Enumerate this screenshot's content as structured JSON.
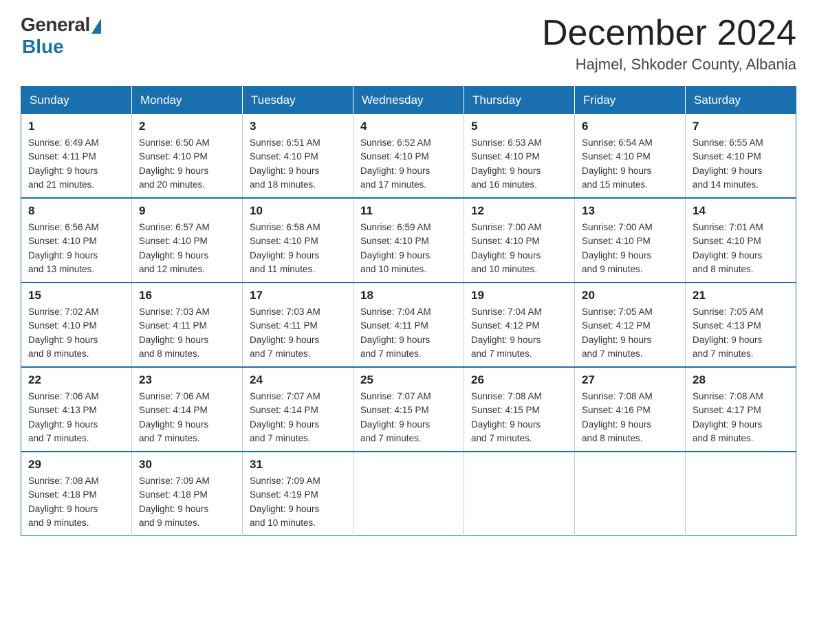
{
  "logo": {
    "general": "General",
    "blue": "Blue"
  },
  "title": "December 2024",
  "location": "Hajmel, Shkoder County, Albania",
  "days_of_week": [
    "Sunday",
    "Monday",
    "Tuesday",
    "Wednesday",
    "Thursday",
    "Friday",
    "Saturday"
  ],
  "weeks": [
    [
      {
        "day": "1",
        "sunrise": "6:49 AM",
        "sunset": "4:11 PM",
        "daylight": "9 hours and 21 minutes."
      },
      {
        "day": "2",
        "sunrise": "6:50 AM",
        "sunset": "4:10 PM",
        "daylight": "9 hours and 20 minutes."
      },
      {
        "day": "3",
        "sunrise": "6:51 AM",
        "sunset": "4:10 PM",
        "daylight": "9 hours and 18 minutes."
      },
      {
        "day": "4",
        "sunrise": "6:52 AM",
        "sunset": "4:10 PM",
        "daylight": "9 hours and 17 minutes."
      },
      {
        "day": "5",
        "sunrise": "6:53 AM",
        "sunset": "4:10 PM",
        "daylight": "9 hours and 16 minutes."
      },
      {
        "day": "6",
        "sunrise": "6:54 AM",
        "sunset": "4:10 PM",
        "daylight": "9 hours and 15 minutes."
      },
      {
        "day": "7",
        "sunrise": "6:55 AM",
        "sunset": "4:10 PM",
        "daylight": "9 hours and 14 minutes."
      }
    ],
    [
      {
        "day": "8",
        "sunrise": "6:56 AM",
        "sunset": "4:10 PM",
        "daylight": "9 hours and 13 minutes."
      },
      {
        "day": "9",
        "sunrise": "6:57 AM",
        "sunset": "4:10 PM",
        "daylight": "9 hours and 12 minutes."
      },
      {
        "day": "10",
        "sunrise": "6:58 AM",
        "sunset": "4:10 PM",
        "daylight": "9 hours and 11 minutes."
      },
      {
        "day": "11",
        "sunrise": "6:59 AM",
        "sunset": "4:10 PM",
        "daylight": "9 hours and 10 minutes."
      },
      {
        "day": "12",
        "sunrise": "7:00 AM",
        "sunset": "4:10 PM",
        "daylight": "9 hours and 10 minutes."
      },
      {
        "day": "13",
        "sunrise": "7:00 AM",
        "sunset": "4:10 PM",
        "daylight": "9 hours and 9 minutes."
      },
      {
        "day": "14",
        "sunrise": "7:01 AM",
        "sunset": "4:10 PM",
        "daylight": "9 hours and 8 minutes."
      }
    ],
    [
      {
        "day": "15",
        "sunrise": "7:02 AM",
        "sunset": "4:10 PM",
        "daylight": "9 hours and 8 minutes."
      },
      {
        "day": "16",
        "sunrise": "7:03 AM",
        "sunset": "4:11 PM",
        "daylight": "9 hours and 8 minutes."
      },
      {
        "day": "17",
        "sunrise": "7:03 AM",
        "sunset": "4:11 PM",
        "daylight": "9 hours and 7 minutes."
      },
      {
        "day": "18",
        "sunrise": "7:04 AM",
        "sunset": "4:11 PM",
        "daylight": "9 hours and 7 minutes."
      },
      {
        "day": "19",
        "sunrise": "7:04 AM",
        "sunset": "4:12 PM",
        "daylight": "9 hours and 7 minutes."
      },
      {
        "day": "20",
        "sunrise": "7:05 AM",
        "sunset": "4:12 PM",
        "daylight": "9 hours and 7 minutes."
      },
      {
        "day": "21",
        "sunrise": "7:05 AM",
        "sunset": "4:13 PM",
        "daylight": "9 hours and 7 minutes."
      }
    ],
    [
      {
        "day": "22",
        "sunrise": "7:06 AM",
        "sunset": "4:13 PM",
        "daylight": "9 hours and 7 minutes."
      },
      {
        "day": "23",
        "sunrise": "7:06 AM",
        "sunset": "4:14 PM",
        "daylight": "9 hours and 7 minutes."
      },
      {
        "day": "24",
        "sunrise": "7:07 AM",
        "sunset": "4:14 PM",
        "daylight": "9 hours and 7 minutes."
      },
      {
        "day": "25",
        "sunrise": "7:07 AM",
        "sunset": "4:15 PM",
        "daylight": "9 hours and 7 minutes."
      },
      {
        "day": "26",
        "sunrise": "7:08 AM",
        "sunset": "4:15 PM",
        "daylight": "9 hours and 7 minutes."
      },
      {
        "day": "27",
        "sunrise": "7:08 AM",
        "sunset": "4:16 PM",
        "daylight": "9 hours and 8 minutes."
      },
      {
        "day": "28",
        "sunrise": "7:08 AM",
        "sunset": "4:17 PM",
        "daylight": "9 hours and 8 minutes."
      }
    ],
    [
      {
        "day": "29",
        "sunrise": "7:08 AM",
        "sunset": "4:18 PM",
        "daylight": "9 hours and 9 minutes."
      },
      {
        "day": "30",
        "sunrise": "7:09 AM",
        "sunset": "4:18 PM",
        "daylight": "9 hours and 9 minutes."
      },
      {
        "day": "31",
        "sunrise": "7:09 AM",
        "sunset": "4:19 PM",
        "daylight": "9 hours and 10 minutes."
      },
      null,
      null,
      null,
      null
    ]
  ],
  "labels": {
    "sunrise": "Sunrise:",
    "sunset": "Sunset:",
    "daylight": "Daylight:"
  }
}
